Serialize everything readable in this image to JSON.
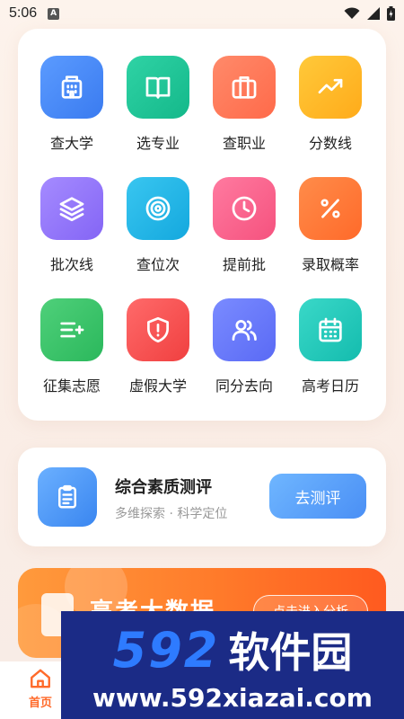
{
  "status_bar": {
    "time": "5:06",
    "a_badge": "A"
  },
  "grid": [
    {
      "label": "查大学",
      "icon": "building-icon",
      "colors": [
        "#5b9bff",
        "#3a7bf0"
      ]
    },
    {
      "label": "选专业",
      "icon": "book-icon",
      "colors": [
        "#2fd3a5",
        "#14b88a"
      ]
    },
    {
      "label": "查职业",
      "icon": "briefcase-icon",
      "colors": [
        "#ff8a6a",
        "#ff6a4a"
      ]
    },
    {
      "label": "分数线",
      "icon": "trend-icon",
      "colors": [
        "#ffc93a",
        "#ffab1a"
      ]
    },
    {
      "label": "批次线",
      "icon": "layers-icon",
      "colors": [
        "#a58bff",
        "#8465f5"
      ]
    },
    {
      "label": "查位次",
      "icon": "target-icon",
      "colors": [
        "#39c6f0",
        "#14a8de"
      ]
    },
    {
      "label": "提前批",
      "icon": "clock-icon",
      "colors": [
        "#ff7aa0",
        "#f5527e"
      ]
    },
    {
      "label": "录取概率",
      "icon": "percent-icon",
      "colors": [
        "#ff8c4a",
        "#ff6a2a"
      ]
    },
    {
      "label": "征集志愿",
      "icon": "list-add-icon",
      "colors": [
        "#4fd07a",
        "#2bb85c"
      ]
    },
    {
      "label": "虚假大学",
      "icon": "shield-alert-icon",
      "colors": [
        "#ff6a6a",
        "#f04040"
      ]
    },
    {
      "label": "同分去向",
      "icon": "users-icon",
      "colors": [
        "#7a8bff",
        "#5a6af5"
      ]
    },
    {
      "label": "高考日历",
      "icon": "calendar-icon",
      "colors": [
        "#3ad8c8",
        "#14bcae"
      ]
    }
  ],
  "evaluation": {
    "title": "综合素质测评",
    "subtitle": "多维探索 · 科学定位",
    "button": "去测评"
  },
  "banner": {
    "title": "高考大数据",
    "button": "点击进入分析"
  },
  "tabbar": {
    "home_label": "首页"
  },
  "watermark": {
    "number": "592",
    "brand": "软件园",
    "url": "www.592xiazai.com"
  }
}
